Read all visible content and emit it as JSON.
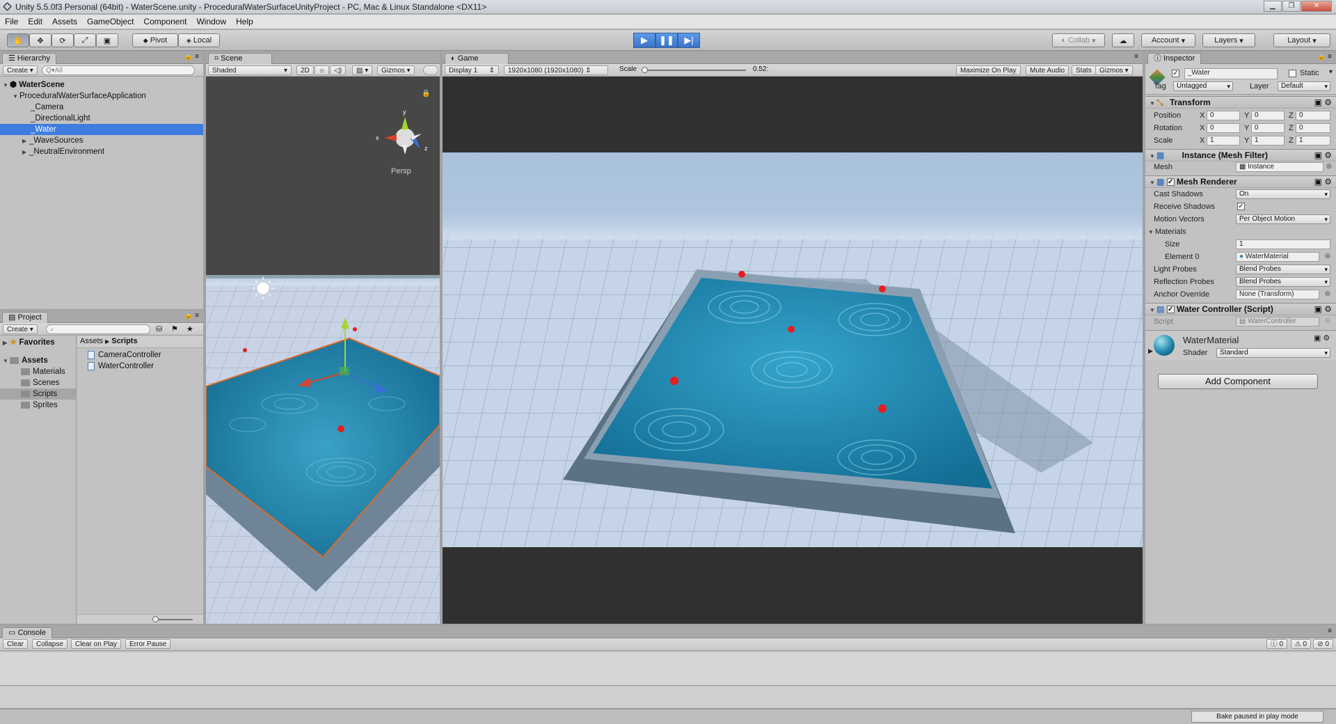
{
  "window": {
    "title": "Unity 5.5.0f3 Personal (64bit) - WaterScene.unity - ProceduralWaterSurfaceUnityProject - PC, Mac & Linux Standalone <DX11>"
  },
  "menu": [
    "File",
    "Edit",
    "Assets",
    "GameObject",
    "Component",
    "Window",
    "Help"
  ],
  "toolbar": {
    "pivot": "Pivot",
    "local": "Local",
    "collab": "Collab",
    "account": "Account",
    "layers": "Layers",
    "layout": "Layout"
  },
  "hierarchy": {
    "tab": "Hierarchy",
    "create": "Create",
    "search_placeholder": "Q▾All",
    "scene": "WaterScene",
    "items": [
      "ProceduralWaterSurfaceApplication",
      "_Camera",
      "_DirectionalLight",
      "_Water",
      "_WaveSources",
      "_NeutralEnvironment"
    ]
  },
  "scene": {
    "tab": "Scene",
    "shading": "Shaded",
    "mode2d": "2D",
    "gizmos": "Gizmos",
    "persp": "Persp",
    "all": "Q▾All"
  },
  "game": {
    "tab": "Game",
    "display": "Display 1",
    "resolution": "1920x1080 (1920x1080)",
    "scale_label": "Scale",
    "scale_value": "0.52:",
    "maximize": "Maximize On Play",
    "mute": "Mute Audio",
    "stats": "Stats",
    "gizmos": "Gizmos"
  },
  "project": {
    "tab": "Project",
    "create": "Create",
    "favorites": "Favorites",
    "assets": "Assets",
    "folders": [
      "Materials",
      "Scenes",
      "Scripts",
      "Sprites"
    ],
    "breadcrumb_root": "Assets",
    "breadcrumb_current": "Scripts",
    "files": [
      "CameraController",
      "WaterController"
    ]
  },
  "inspector": {
    "tab": "Inspector",
    "object_name": "_Water",
    "static": "Static",
    "tag_label": "Tag",
    "tag_value": "Untagged",
    "layer_label": "Layer",
    "layer_value": "Default",
    "transform": {
      "title": "Transform",
      "position": "Position",
      "rotation": "Rotation",
      "scale": "Scale",
      "x": "X",
      "y": "Y",
      "z": "Z",
      "pos": [
        "0",
        "0",
        "0"
      ],
      "rot": [
        "0",
        "0",
        "0"
      ],
      "scl": [
        "1",
        "1",
        "1"
      ]
    },
    "mesh_filter": {
      "title": "Instance (Mesh Filter)",
      "mesh_label": "Mesh",
      "mesh_value": "Instance"
    },
    "mesh_renderer": {
      "title": "Mesh Renderer",
      "cast_shadows": "Cast Shadows",
      "cast_value": "On",
      "receive_shadows": "Receive Shadows",
      "receive_mark": "✓",
      "motion_vectors": "Motion Vectors",
      "motion_value": "Per Object Motion",
      "materials": "Materials",
      "size": "Size",
      "size_value": "1",
      "element0": "Element 0",
      "element0_value": "WaterMaterial",
      "light_probes": "Light Probes",
      "light_value": "Blend Probes",
      "reflection_probes": "Reflection Probes",
      "reflection_value": "Blend Probes",
      "anchor_override": "Anchor Override",
      "anchor_value": "None (Transform)"
    },
    "water_controller": {
      "title": "Water Controller (Script)",
      "script_label": "Script",
      "script_value": "WaterController"
    },
    "material": {
      "name": "WaterMaterial",
      "shader_label": "Shader",
      "shader_value": "Standard"
    },
    "add_component": "Add Component"
  },
  "console": {
    "tab": "Console",
    "clear": "Clear",
    "collapse": "Collapse",
    "clear_on_play": "Clear on Play",
    "error_pause": "Error Pause",
    "info_count": "0",
    "warn_count": "0",
    "error_count": "0"
  },
  "status": {
    "bake": "Bake paused in play mode"
  },
  "colors": {
    "selection": "#3e7ce0",
    "play_accent": "#3a73c8",
    "water": "#1f86ad",
    "sky": "#c9d7ec"
  }
}
